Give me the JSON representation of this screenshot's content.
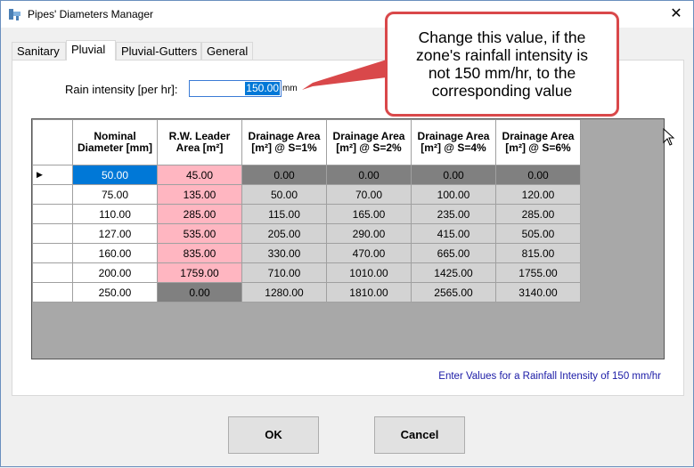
{
  "window": {
    "title": "Pipes' Diameters Manager",
    "close_glyph": "✕"
  },
  "tabs": [
    {
      "label": "Sanitary",
      "active": false
    },
    {
      "label": "Pluvial",
      "active": true
    },
    {
      "label": "Pluvial-Gutters",
      "active": false
    },
    {
      "label": "General",
      "active": false
    }
  ],
  "rain": {
    "label": "Rain intensity [per hr]:",
    "value": "150.00",
    "unit": "mm"
  },
  "grid": {
    "columns": [
      "Nominal Diameter [mm]",
      "R.W. Leader Area [m²]",
      "Drainage Area [m²] @ S=1%",
      "Drainage Area [m²] @ S=2%",
      "Drainage Area [m²] @ S=4%",
      "Drainage Area [m²] @ S=6%"
    ],
    "current_row_marker": "▶",
    "rows": [
      [
        "50.00",
        "45.00",
        "0.00",
        "0.00",
        "0.00",
        "0.00"
      ],
      [
        "75.00",
        "135.00",
        "50.00",
        "70.00",
        "100.00",
        "120.00"
      ],
      [
        "110.00",
        "285.00",
        "115.00",
        "165.00",
        "235.00",
        "285.00"
      ],
      [
        "127.00",
        "535.00",
        "205.00",
        "290.00",
        "415.00",
        "505.00"
      ],
      [
        "160.00",
        "835.00",
        "330.00",
        "470.00",
        "665.00",
        "815.00"
      ],
      [
        "200.00",
        "1759.00",
        "710.00",
        "1010.00",
        "1425.00",
        "1755.00"
      ],
      [
        "250.00",
        "0.00",
        "1280.00",
        "1810.00",
        "2565.00",
        "3140.00"
      ]
    ],
    "cell_colors": {
      "selected": "#0078d7",
      "leader": "#ffb6c1",
      "disabled": "#808080",
      "computed": "#d3d3d3",
      "background": "#a8a8a8"
    }
  },
  "hint": "Enter Values for a Rainfall Intensity of 150 mm/hr",
  "buttons": {
    "ok": "OK",
    "cancel": "Cancel"
  },
  "callout": {
    "lines": [
      "Change this value, if the",
      "zone's rainfall intensity is",
      "not 150 mm/hr, to the",
      "corresponding value"
    ],
    "border_color": "#d9484a"
  },
  "icons": {
    "app": "pipe-app-icon",
    "close": "close-icon",
    "cursor": "mouse-pointer-icon"
  }
}
